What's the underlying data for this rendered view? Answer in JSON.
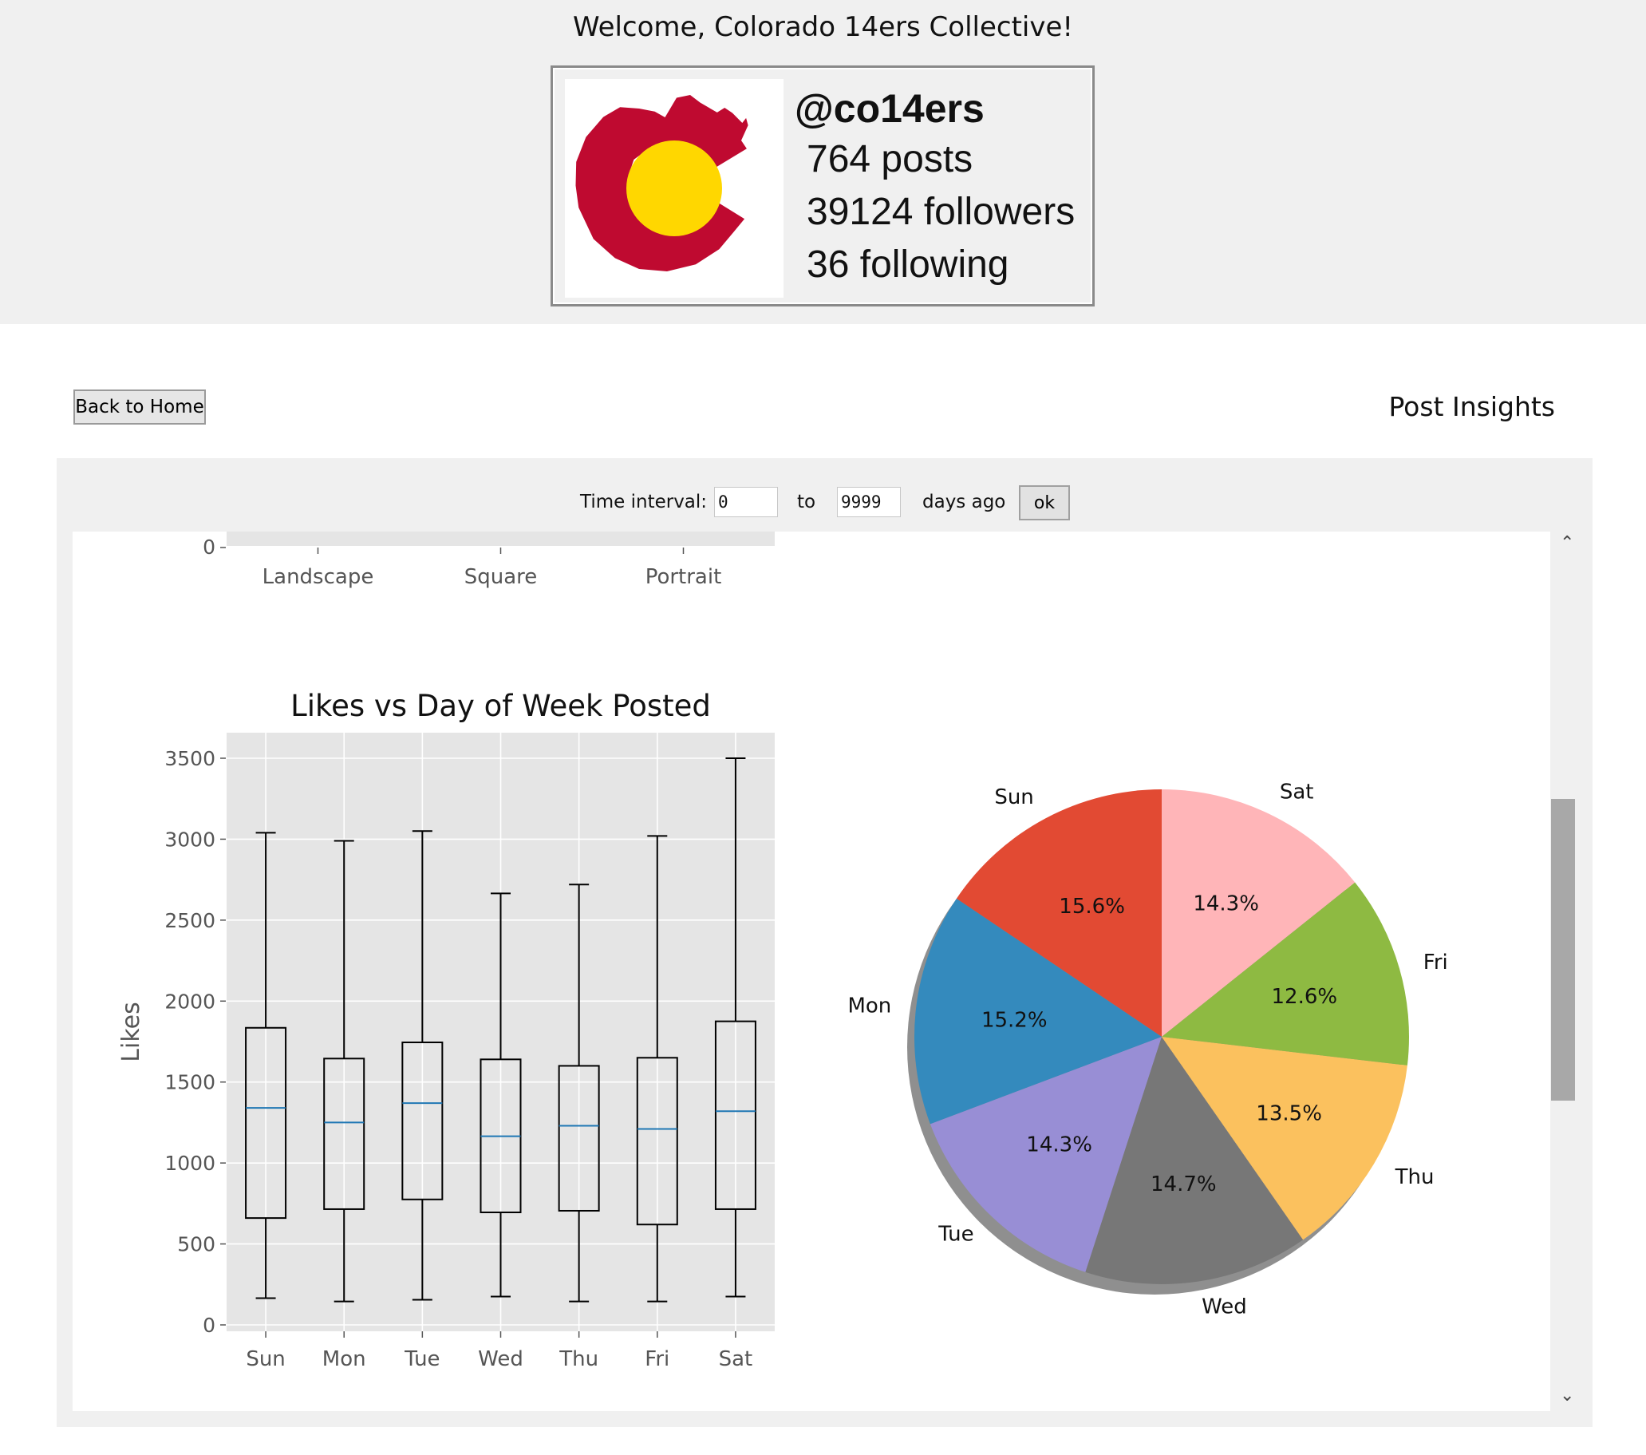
{
  "welcome": "Welcome, Colorado 14ers Collective!",
  "profile": {
    "handle": "@co14ers",
    "posts": "764 posts",
    "followers": "39124 followers",
    "following": "36 following",
    "avatar_colors": {
      "red": "#bf0a30",
      "gold": "#ffd700"
    }
  },
  "nav": {
    "back_label": "Back to Home",
    "page_title": "Post Insights"
  },
  "filter": {
    "label": "Time interval:",
    "from_value": "0",
    "to_label": "to",
    "to_value": "9999",
    "unit_label": "days ago",
    "ok_label": "ok"
  },
  "scroll": {
    "up_icon": "chevron-up-icon",
    "down_icon": "chevron-down-icon"
  },
  "chart_data": [
    {
      "type": "bar",
      "partial": true,
      "categories": [
        "Landscape",
        "Square",
        "Portrait"
      ],
      "ytick_visible": "0"
    },
    {
      "type": "box",
      "title": "Likes vs Day of Week Posted",
      "ylabel": "Likes",
      "ylim": [
        0,
        3650
      ],
      "yticks": [
        0,
        500,
        1000,
        1500,
        2000,
        2500,
        3000,
        3500
      ],
      "grid": true,
      "categories": [
        "Sun",
        "Mon",
        "Tue",
        "Wed",
        "Thu",
        "Fri",
        "Sat"
      ],
      "boxes": [
        {
          "min": 165,
          "q1": 660,
          "median": 1340,
          "q3": 1835,
          "max": 3040
        },
        {
          "min": 145,
          "q1": 715,
          "median": 1250,
          "q3": 1645,
          "max": 2990
        },
        {
          "min": 155,
          "q1": 775,
          "median": 1370,
          "q3": 1745,
          "max": 3050
        },
        {
          "min": 175,
          "q1": 695,
          "median": 1165,
          "q3": 1640,
          "max": 2665
        },
        {
          "min": 145,
          "q1": 705,
          "median": 1230,
          "q3": 1600,
          "max": 2720
        },
        {
          "min": 145,
          "q1": 620,
          "median": 1210,
          "q3": 1650,
          "max": 3020
        },
        {
          "min": 175,
          "q1": 715,
          "median": 1320,
          "q3": 1875,
          "max": 3500
        }
      ]
    },
    {
      "type": "pie",
      "shadow": true,
      "slices": [
        {
          "label": "Sun",
          "pct": 15.6,
          "pct_label": "15.6%",
          "color": "#e24a33"
        },
        {
          "label": "Mon",
          "pct": 15.2,
          "pct_label": "15.2%",
          "color": "#348abd"
        },
        {
          "label": "Tue",
          "pct": 14.3,
          "pct_label": "14.3%",
          "color": "#988ed5"
        },
        {
          "label": "Wed",
          "pct": 14.7,
          "pct_label": "14.7%",
          "color": "#777777"
        },
        {
          "label": "Thu",
          "pct": 13.5,
          "pct_label": "13.5%",
          "color": "#fbc15e"
        },
        {
          "label": "Fri",
          "pct": 12.6,
          "pct_label": "12.6%",
          "color": "#8eba42"
        },
        {
          "label": "Sat",
          "pct": 14.3,
          "pct_label": "14.3%",
          "color": "#ffb5b8"
        }
      ]
    }
  ]
}
